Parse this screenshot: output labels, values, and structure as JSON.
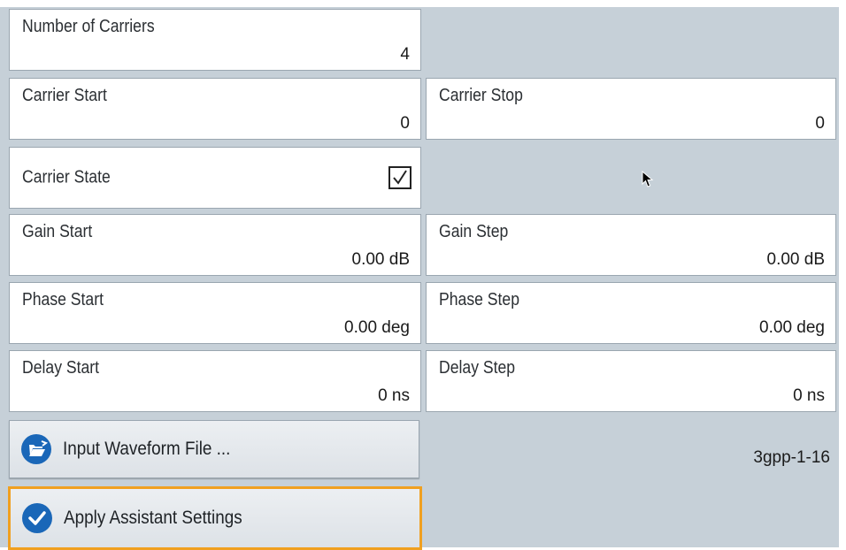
{
  "fields": {
    "num_carriers": {
      "label": "Number of Carriers",
      "value": "4"
    },
    "carrier_start": {
      "label": "Carrier Start",
      "value": "0"
    },
    "carrier_stop": {
      "label": "Carrier Stop",
      "value": "0"
    },
    "carrier_state": {
      "label": "Carrier State",
      "checked": true
    },
    "gain_start": {
      "label": "Gain Start",
      "value": "0.00 dB"
    },
    "gain_step": {
      "label": "Gain Step",
      "value": "0.00 dB"
    },
    "phase_start": {
      "label": "Phase Start",
      "value": "0.00 deg"
    },
    "phase_step": {
      "label": "Phase Step",
      "value": "0.00 deg"
    },
    "delay_start": {
      "label": "Delay Start",
      "value": "0 ns"
    },
    "delay_step": {
      "label": "Delay Step",
      "value": "0 ns"
    }
  },
  "buttons": {
    "input_waveform": {
      "label": "Input Waveform File ...",
      "icon": "folder-open-icon"
    },
    "apply_settings": {
      "label": "Apply Assistant Settings",
      "icon": "checkmark-icon"
    }
  },
  "waveform_file": "3gpp-1-16",
  "colors": {
    "panel_bg": "#c6d0d8",
    "accent_blue": "#1a67b8",
    "focus_orange": "#f0a020"
  }
}
